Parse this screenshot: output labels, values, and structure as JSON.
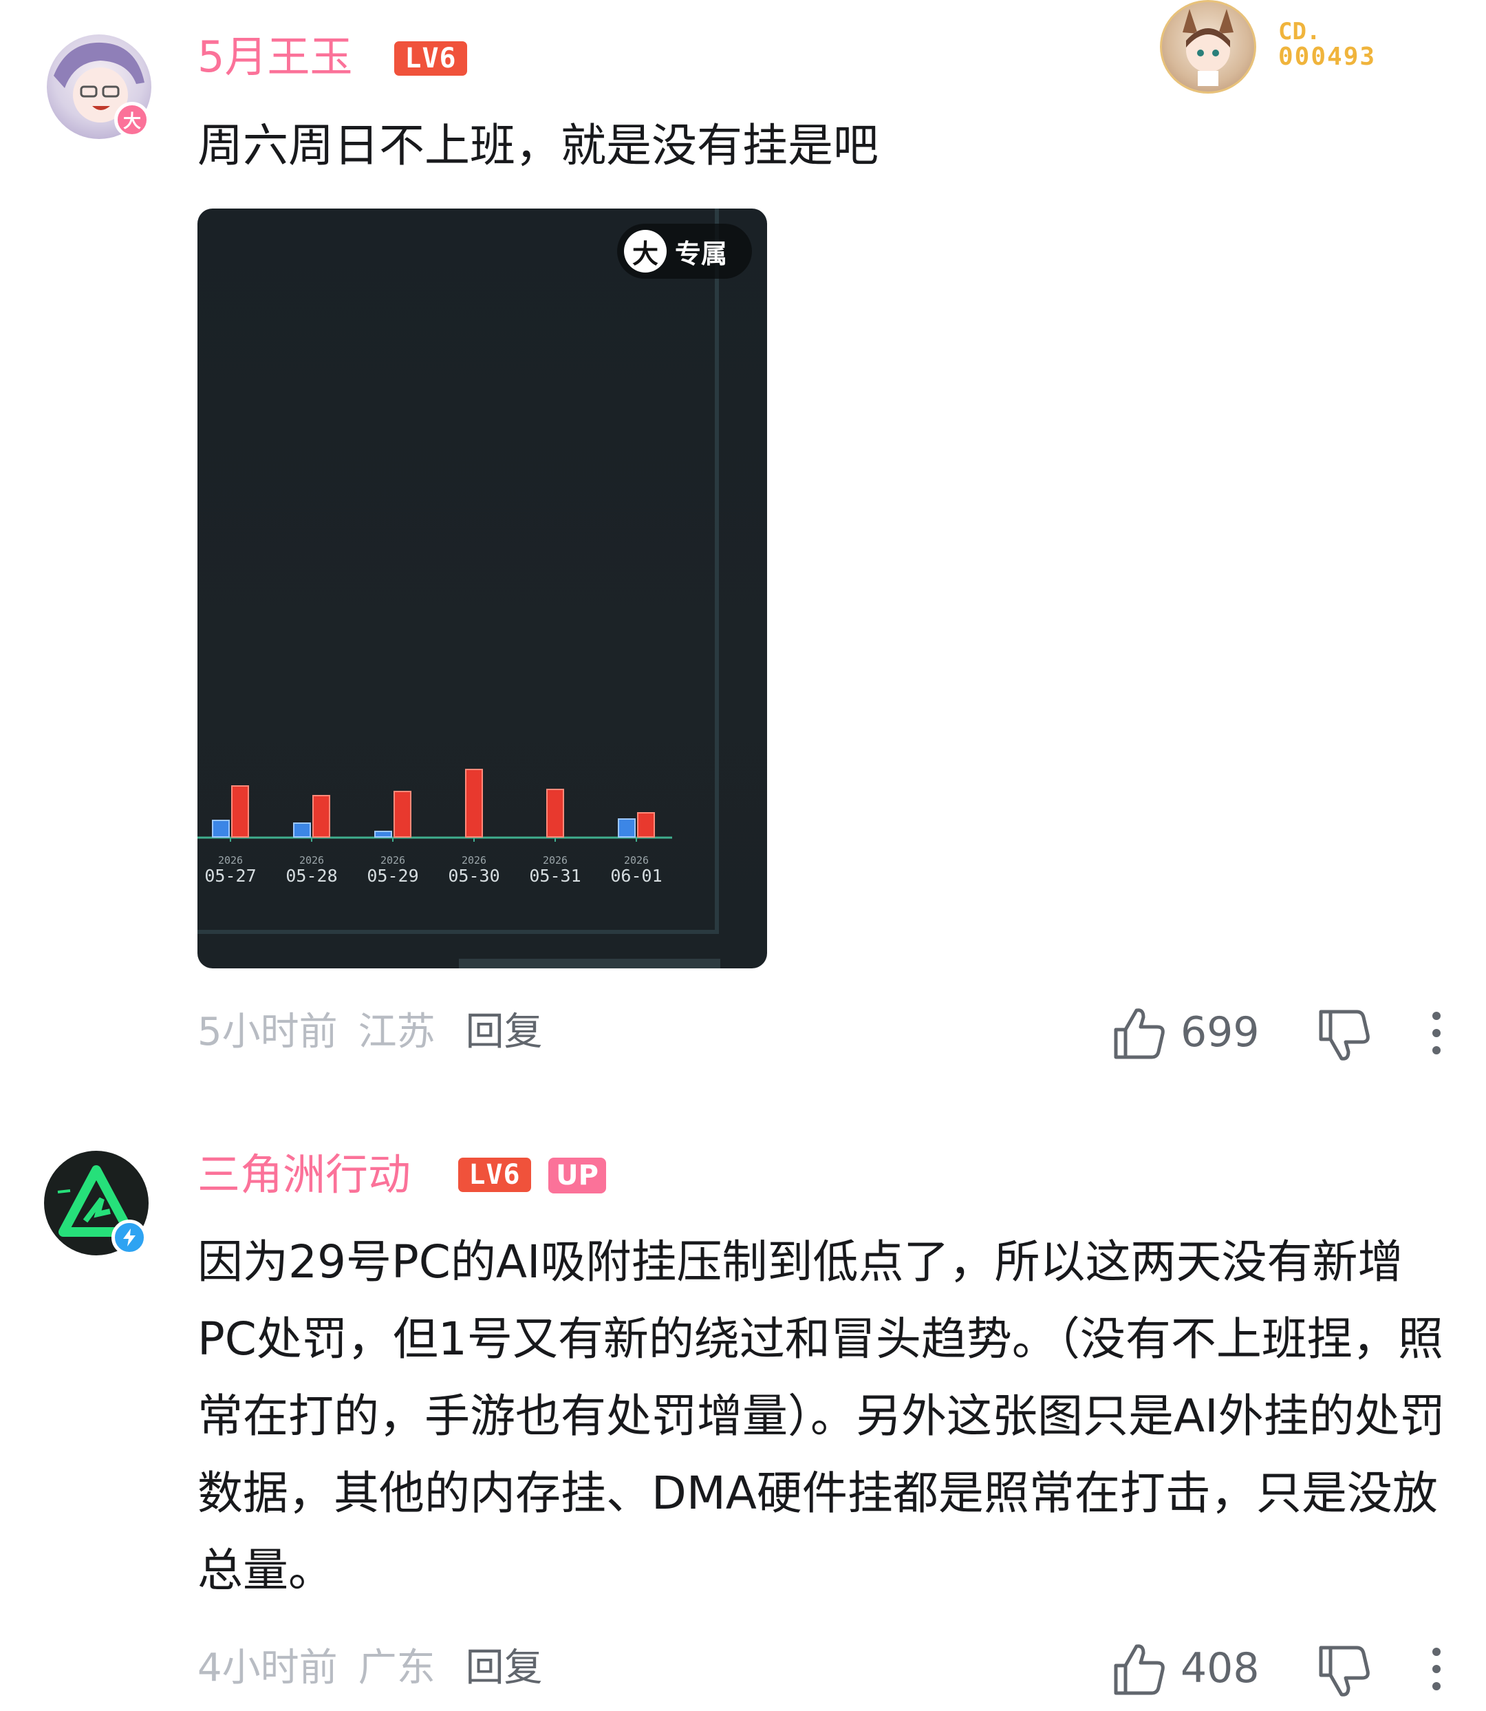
{
  "comments": [
    {
      "username": "5月王玉",
      "level": "LV6",
      "avatar_badge": "大",
      "text": "周六周日不上班，就是没有挂是吧",
      "time": "5小时前",
      "location": "江苏",
      "reply_label": "回复",
      "likes": "699",
      "image": {
        "exclusive_badge_icon": "大",
        "exclusive_badge_label": "专属",
        "chart_data": {
          "type": "bar",
          "categories": [
            "05-27",
            "05-28",
            "05-29",
            "05-30",
            "05-31",
            "06-01"
          ],
          "category_years": [
            "2026",
            "2026",
            "2026",
            "2026",
            "2026",
            "2026"
          ],
          "series": [
            {
              "color": "#3c86e6",
              "values": [
                0.24,
                0.2,
                0.08,
                0,
                0,
                0.26
              ]
            },
            {
              "color": "#e8392e",
              "values": [
                0.74,
                0.6,
                0.66,
                0.98,
                0.69,
                0.35
              ]
            }
          ],
          "title": "",
          "xlabel": "",
          "ylabel": ""
        }
      }
    },
    {
      "username": "三角洲行动",
      "level": "LV6",
      "up_tag": "UP",
      "text": "因为29号PC的AI吸附挂压制到低点了，所以这两天没有新增PC处罚，但1号又有新的绕过和冒头趋势。（没有不上班捏，照常在打的，手游也有处罚增量）。另外这张图只是AI外挂的处罚数据，其他的内存挂、DMA硬件挂都是照常在打击，只是没放总量。",
      "time": "4小时前",
      "location": "广东",
      "reply_label": "回复",
      "likes": "408"
    }
  ],
  "fan_badge": {
    "line1": "CD.",
    "line2": "000493",
    "color": "#f0b43c"
  },
  "colors": {
    "username": "#fb7299",
    "level_badge": "#f0523b",
    "meta": "#b8bcc3",
    "action": "#61666d"
  }
}
